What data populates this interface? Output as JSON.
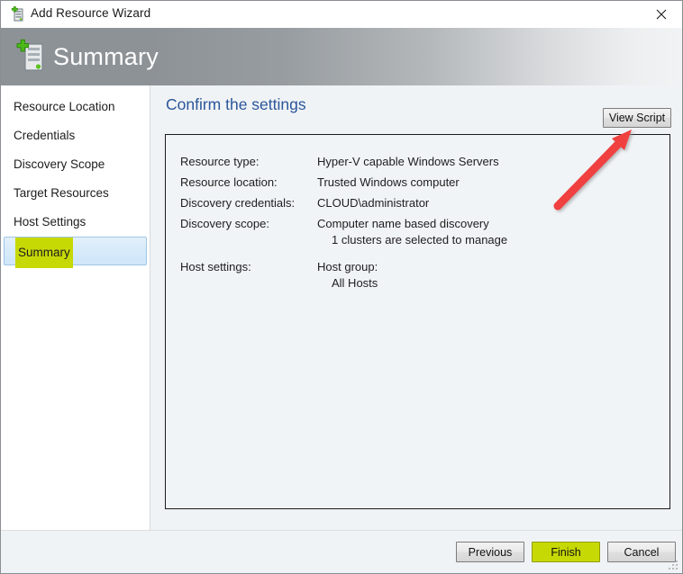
{
  "window": {
    "title": "Add Resource Wizard",
    "title_icon": "server-add-icon",
    "close_icon": "close-icon",
    "resize_grip_icon": "resize-grip-icon"
  },
  "header": {
    "title": "Summary",
    "icon": "server-add-icon"
  },
  "sidebar": {
    "items": [
      {
        "label": "Resource Location",
        "selected": false
      },
      {
        "label": "Credentials",
        "selected": false
      },
      {
        "label": "Discovery Scope",
        "selected": false
      },
      {
        "label": "Target Resources",
        "selected": false
      },
      {
        "label": "Host Settings",
        "selected": false
      },
      {
        "label": "Summary",
        "selected": true
      }
    ]
  },
  "content": {
    "heading": "Confirm the settings",
    "view_script_label": "View Script",
    "rows": [
      {
        "label": "Resource type:",
        "value": "Hyper-V capable Windows Servers",
        "sub": ""
      },
      {
        "label": "Resource location:",
        "value": "Trusted Windows computer",
        "sub": ""
      },
      {
        "label": "Discovery credentials:",
        "value": "CLOUD\\administrator",
        "sub": ""
      },
      {
        "label": "Discovery scope:",
        "value": "Computer name based discovery",
        "sub": "1 clusters are selected to manage"
      },
      {
        "label": "Host settings:",
        "value": "Host group:",
        "sub": "All Hosts"
      }
    ]
  },
  "footer": {
    "previous_label": "Previous",
    "finish_label": "Finish",
    "cancel_label": "Cancel"
  },
  "annotation": {
    "type": "red-arrow",
    "points_to": "View Script",
    "color": "#f04040"
  },
  "colors": {
    "highlight_yellow_green": "#c7d905",
    "heading_blue": "#2a5699",
    "header_gradient_left": "#8d9297",
    "header_gradient_right": "#f1f3f4",
    "selected_row_blue": "#d6eafa",
    "panel_background": "#f1f4f7",
    "annotation_red": "#f04040"
  }
}
